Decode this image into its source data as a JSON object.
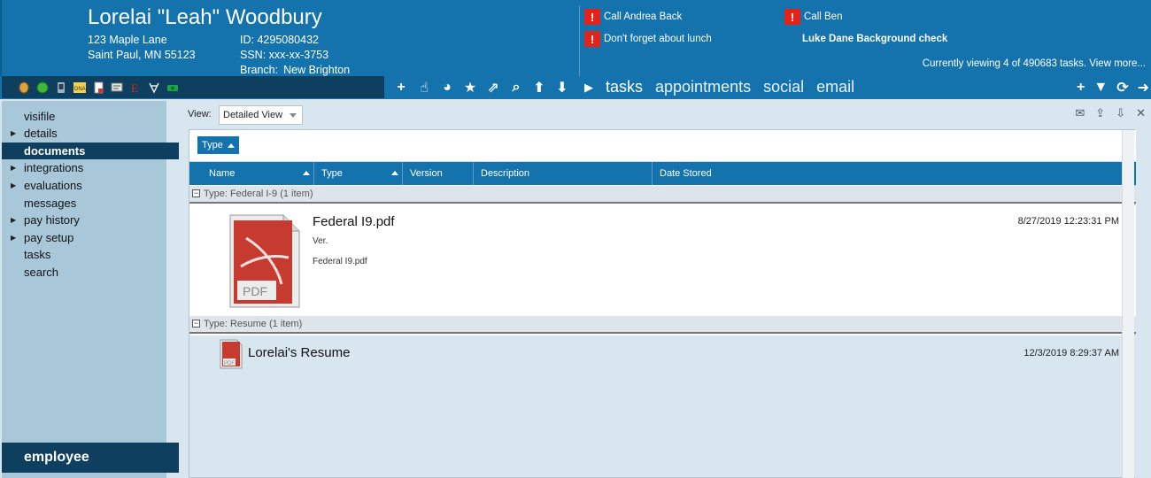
{
  "employee": {
    "name": "Lorelai \"Leah\" Woodbury",
    "address_line1": "123 Maple Lane",
    "address_line2": "Saint Paul, MN 55123",
    "id_label": "ID:",
    "id_value": "4295080432",
    "ssn_label": "SSN:",
    "ssn_value": "xxx-xx-3753",
    "branch_label": "Branch:",
    "branch_value": "New Brighton"
  },
  "alerts": [
    {
      "text": "Call Andrea Back",
      "flag": true
    },
    {
      "text": "Call Ben",
      "flag": true
    },
    {
      "text": "Don't forget about lunch",
      "flag": true
    },
    {
      "text": "Luke Dane Background check",
      "flag": false
    }
  ],
  "viewing_text": "Currently viewing 4 of 490683 tasks. View more...",
  "iconbar": [
    "coin-icon",
    "green-circle-icon",
    "phone-icon",
    "dna-icon",
    "document-icon",
    "card-icon",
    "e-verify-icon",
    "medical-icon",
    "money-icon"
  ],
  "toolbar": {
    "add": "+",
    "pointer": "☝",
    "pie": "◕",
    "star": "★",
    "external": "⇗",
    "search": "⌕",
    "up": "⬆",
    "down": "⬇"
  },
  "navtabs": {
    "play": "▶",
    "tasks": "tasks",
    "appointments": "appointments",
    "social": "social",
    "email": "email"
  },
  "rtools": {
    "add": "+",
    "filter": "▼",
    "refresh": "⟳",
    "arrow": "➜"
  },
  "sidebar": {
    "items": [
      {
        "label": "visifile",
        "arrow": ""
      },
      {
        "label": "details",
        "arrow": "▶"
      },
      {
        "label": "documents",
        "arrow": ""
      },
      {
        "label": "integrations",
        "arrow": "▶"
      },
      {
        "label": "evaluations",
        "arrow": "▶"
      },
      {
        "label": "messages",
        "arrow": ""
      },
      {
        "label": "pay history",
        "arrow": "▶"
      },
      {
        "label": "pay setup",
        "arrow": "▶"
      },
      {
        "label": "tasks",
        "arrow": ""
      },
      {
        "label": "search",
        "arrow": ""
      }
    ],
    "footer": "employee"
  },
  "main": {
    "view_label": "View:",
    "view_value": "Detailed View",
    "tools": {
      "mail": "✉",
      "upload": "⇪",
      "download": "⇩",
      "close": "✕"
    },
    "group_chip": "Type",
    "columns": [
      "Name",
      "Type",
      "Version",
      "Description",
      "Date Stored"
    ],
    "groups": [
      {
        "label": "Type: Federal I-9 (1 item)",
        "minus": "−",
        "doc": {
          "name": "Federal I9.pdf",
          "ver": "Ver.",
          "description": "Federal I9.pdf",
          "date": "8/27/2019 12:23:31 PM",
          "thumb_text": "PDF"
        }
      },
      {
        "label": "Type: Resume (1 item)",
        "minus": "−",
        "doc": {
          "name": "Lorelai's Resume",
          "date": "12/3/2019 8:29:37 AM",
          "thumb_text": "PDF"
        }
      }
    ]
  },
  "colors": {
    "brand": "#1473ad",
    "dark": "#0f3f5e",
    "sidebar": "#a8c8da",
    "alert": "#e2231a"
  }
}
